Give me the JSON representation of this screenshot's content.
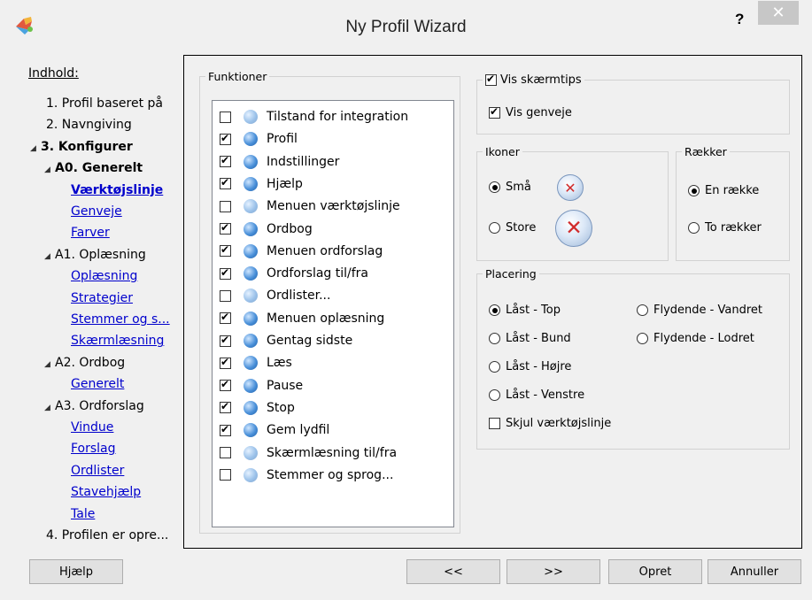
{
  "window": {
    "title": "Ny Profil Wizard",
    "help_label": "?",
    "close_label": "✕"
  },
  "nav": {
    "heading": "Indhold:",
    "items": [
      {
        "label": "1. Profil baseret på",
        "kind": "plain"
      },
      {
        "label": "2. Navngiving",
        "kind": "plain"
      },
      {
        "label": "3. Konfigurer",
        "kind": "bold",
        "expander": "◢"
      },
      {
        "label": "A0. Generelt",
        "kind": "bold",
        "expander": "◢"
      },
      {
        "label": "Værktøjslinje",
        "kind": "link-bold"
      },
      {
        "label": "Genveje",
        "kind": "link"
      },
      {
        "label": "Farver",
        "kind": "link"
      },
      {
        "label": "A1. Oplæsning",
        "kind": "plain",
        "expander": "◢"
      },
      {
        "label": "Oplæsning",
        "kind": "link"
      },
      {
        "label": "Strategier",
        "kind": "link"
      },
      {
        "label": "Stemmer og s...",
        "kind": "link"
      },
      {
        "label": "Skærmlæsning",
        "kind": "link"
      },
      {
        "label": "A2. Ordbog",
        "kind": "plain",
        "expander": "◢"
      },
      {
        "label": "Generelt",
        "kind": "link"
      },
      {
        "label": "A3. Ordforslag",
        "kind": "plain",
        "expander": "◢"
      },
      {
        "label": "Vindue",
        "kind": "link"
      },
      {
        "label": "Forslag",
        "kind": "link"
      },
      {
        "label": "Ordlister",
        "kind": "link"
      },
      {
        "label": "Stavehjælp",
        "kind": "link"
      },
      {
        "label": "Tale",
        "kind": "link"
      },
      {
        "label": "4. Profilen er opre...",
        "kind": "plain"
      }
    ]
  },
  "functions": {
    "legend": "Funktioner",
    "items": [
      {
        "label": "Tilstand for integration",
        "checked": false
      },
      {
        "label": "Profil",
        "checked": true
      },
      {
        "label": "Indstillinger",
        "checked": true
      },
      {
        "label": "Hjælp",
        "checked": true
      },
      {
        "label": "Menuen værktøjslinje",
        "checked": false
      },
      {
        "label": "Ordbog",
        "checked": true
      },
      {
        "label": "Menuen ordforslag",
        "checked": true
      },
      {
        "label": "Ordforslag til/fra",
        "checked": true
      },
      {
        "label": "Ordlister...",
        "checked": false
      },
      {
        "label": "Menuen oplæsning",
        "checked": true
      },
      {
        "label": "Gentag sidste",
        "checked": true
      },
      {
        "label": "Læs",
        "checked": true
      },
      {
        "label": "Pause",
        "checked": true
      },
      {
        "label": "Stop",
        "checked": true
      },
      {
        "label": "Gem lydfil",
        "checked": true
      },
      {
        "label": "Skærmlæsning til/fra",
        "checked": false
      },
      {
        "label": "Stemmer og sprog...",
        "checked": false
      }
    ]
  },
  "tooltips": {
    "show_tips_label": "Vis skærmtips",
    "show_tips_checked": true,
    "show_shortcuts_label": "Vis genveje",
    "show_shortcuts_checked": true
  },
  "icons_group": {
    "legend": "Ikoner",
    "small_label": "Små",
    "large_label": "Store",
    "selected": "small"
  },
  "rows_group": {
    "legend": "Rækker",
    "one_label": "En række",
    "two_label": "To rækker",
    "selected": "one"
  },
  "placement": {
    "legend": "Placering",
    "locked_top": "Låst - Top",
    "locked_bottom": "Låst - Bund",
    "locked_right": "Låst - Højre",
    "locked_left": "Låst - Venstre",
    "floating_horizontal": "Flydende - Vandret",
    "floating_vertical": "Flydende - Lodret",
    "selected": "locked_top",
    "hide_toolbar_label": "Skjul værktøjslinje",
    "hide_toolbar_checked": false
  },
  "buttons": {
    "help": "Hjælp",
    "back": "<<",
    "next": ">>",
    "create": "Opret",
    "cancel": "Annuller"
  }
}
